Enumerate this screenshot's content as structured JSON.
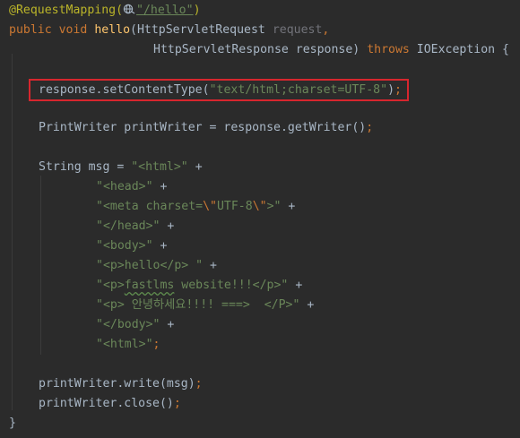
{
  "colors": {
    "background": "#2b2b2b",
    "annotation": "#bbb529",
    "keyword": "#cc7832",
    "method": "#ffc66d",
    "string": "#6a8759",
    "text": "#a9b7c6",
    "unused_param": "#72737a",
    "highlight_border": "#d7262e"
  },
  "icons": {
    "url_marker": "globe-icon"
  },
  "code": {
    "l1": {
      "annotation": "@RequestMapping(",
      "url": "\"/hello\"",
      "close": ")"
    },
    "l2": {
      "kw1": "public",
      "kw2": "void",
      "method": "hello",
      "open": "(HttpServletRequest ",
      "param": "request",
      "comma": ","
    },
    "l3": {
      "type": "HttpServletResponse response) ",
      "throws": "throws",
      "exc": " IOException {"
    },
    "l5": {
      "call": "response.setContentType(",
      "str": "\"text/html;charset=UTF-8\"",
      "close": ")",
      "semi": ";"
    },
    "l7": {
      "text": "PrintWriter printWriter = response.getWriter()",
      "semi": ";"
    },
    "l9": {
      "decl": "String msg = ",
      "str": "\"<html>\"",
      "plus": " +"
    },
    "l10": {
      "str": "\"<head>\"",
      "plus": " +"
    },
    "l11": {
      "s1": "\"<meta charset=",
      "esc1": "\\\"",
      "s2": "UTF-8",
      "esc2": "\\\"",
      "s3": ">\"",
      "plus": " +"
    },
    "l12": {
      "str": "\"</head>\"",
      "plus": " +"
    },
    "l13": {
      "str": "\"<body>\"",
      "plus": " +"
    },
    "l14": {
      "str": "\"<p>hello</p> \"",
      "plus": " +"
    },
    "l15": {
      "q": "\"<p>",
      "typo": "fastlms",
      "rest": " website!!!</p>\"",
      "plus": " +"
    },
    "l16": {
      "str": "\"<p> 안녕하세요!!!! ===>  </P>\"",
      "plus": " +"
    },
    "l17": {
      "str": "\"</body>\"",
      "plus": " +"
    },
    "l18": {
      "str": "\"<html>\"",
      "semi": ";"
    },
    "l20": {
      "text": "printWriter.write(msg)",
      "semi": ";"
    },
    "l21": {
      "text": "printWriter.close()",
      "semi": ";"
    },
    "l22": {
      "brace": "}"
    }
  }
}
